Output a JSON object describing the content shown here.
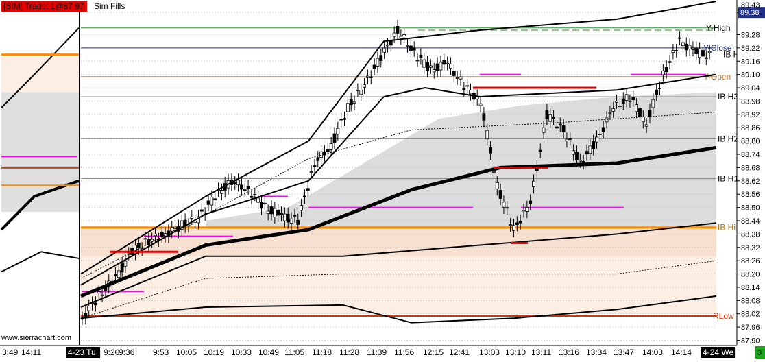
{
  "header": {
    "trade_text": "[SIM]  Trade: 1@87.97",
    "fills_text": "Sim Fills",
    "watermark": "www.sierrachart.com"
  },
  "price_axis": {
    "current_price": "89.38",
    "top_partial": "89.43",
    "bottom_marker": "3"
  },
  "time_axis": {
    "labels": [
      "3:49",
      "14:11",
      "4-23 Tu",
      "9:20",
      "9:36",
      "9:53",
      "10:05",
      "10:19",
      "10:33",
      "10:49",
      "11:05",
      "11:18",
      "11:28",
      "11:39",
      "11:56",
      "12:15",
      "12:41",
      "13:03",
      "13:10",
      "13:11",
      "13:16",
      "13:34",
      "13:47",
      "14:03",
      "14:14",
      "4-24 We"
    ]
  },
  "level_labels": {
    "y_high": "Y-High",
    "y_close": "Y-Close",
    "y_open": "Y-Open",
    "ib_h3": "IB H3",
    "ib_h2": "IB H2",
    "ib_h1": "IB H1",
    "ib_hi": "IB Hi",
    "r_low": "RLow",
    "ib_h_edge": "IB H"
  },
  "colors": {
    "sim_badge": "#e60000",
    "current_price_bg": "#1f2f88",
    "date_marker_bg": "#000000",
    "right_marker_bg": "#1aa51a",
    "ib_hi_line": "#ff8c00",
    "y_high_line": "#2a8f2a",
    "y_close_line": "#1f2f88",
    "y_open_line": "#b8732b",
    "rlow_line": "#e03000",
    "magenta_level": "#ff00ff",
    "band_grey": "#dcdcdc",
    "band_peach": "#f5dccb",
    "band_light_peach": "#fdeee4"
  },
  "chart_data": {
    "type": "candlestick",
    "ylim": [
      87.88,
      89.43
    ],
    "y_ticks": [
      89.38,
      89.28,
      89.22,
      89.16,
      89.1,
      89.04,
      88.98,
      88.92,
      88.86,
      88.8,
      88.74,
      88.68,
      88.62,
      88.56,
      88.5,
      88.44,
      88.38,
      88.32,
      88.26,
      88.2,
      88.14,
      88.08,
      88.02,
      87.96,
      87.9
    ],
    "y_tick_labels": [
      "89.38",
      "89.28",
      "89.22",
      "89.16",
      "89.10",
      "89.04",
      "88.98",
      "88.92",
      "88.86",
      "88.80",
      "88.74",
      "88.68",
      "88.62",
      "88.56",
      "88.50",
      "88.44",
      "88.38",
      "88.32",
      "88.26",
      "88.20",
      "88.14",
      "88.08",
      "88.02",
      "87.96",
      "87.90"
    ],
    "levels": [
      {
        "name": "Y-High",
        "value": 89.31
      },
      {
        "name": "Y-Close",
        "value": 89.22
      },
      {
        "name": "Y-Open",
        "value": 89.09
      },
      {
        "name": "IB H3",
        "value": 89.0
      },
      {
        "name": "IB H2",
        "value": 88.81
      },
      {
        "name": "IB H1",
        "value": 88.63
      },
      {
        "name": "IB Hi",
        "value": 88.41
      },
      {
        "name": "RLow",
        "value": 88.01
      }
    ],
    "price_path": [
      88.0,
      88.1,
      88.18,
      88.3,
      88.35,
      88.38,
      88.42,
      88.45,
      88.55,
      88.62,
      88.58,
      88.5,
      88.46,
      88.44,
      88.7,
      88.78,
      88.95,
      89.05,
      89.18,
      89.3,
      89.2,
      89.12,
      89.15,
      89.05,
      88.98,
      88.6,
      88.4,
      88.52,
      88.92,
      88.85,
      88.7,
      88.8,
      88.95,
      89.0,
      88.88,
      89.1,
      89.25,
      89.2,
      89.18
    ]
  }
}
